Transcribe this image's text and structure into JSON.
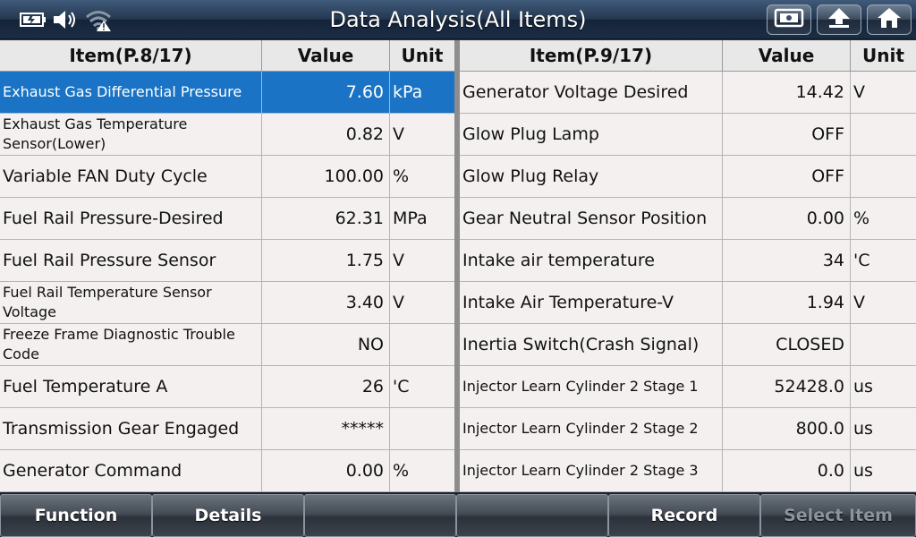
{
  "title": "Data Analysis(All Items)",
  "left_table": {
    "headers": {
      "item": "Item(P.8/17)",
      "value": "Value",
      "unit": "Unit"
    },
    "rows": [
      {
        "name": "Exhaust Gas Differential Pressure",
        "value": "7.60",
        "unit": "kPa"
      },
      {
        "name": "Exhaust Gas Temperature Sensor(Lower)",
        "value": "0.82",
        "unit": "V"
      },
      {
        "name": "Variable FAN Duty Cycle",
        "value": "100.00",
        "unit": "%"
      },
      {
        "name": "Fuel Rail Pressure-Desired",
        "value": "62.31",
        "unit": "MPa"
      },
      {
        "name": "Fuel Rail Pressure Sensor",
        "value": "1.75",
        "unit": "V"
      },
      {
        "name": "Fuel Rail Temperature Sensor Voltage",
        "value": "3.40",
        "unit": "V"
      },
      {
        "name": "Freeze Frame Diagnostic Trouble Code",
        "value": "NO",
        "unit": ""
      },
      {
        "name": "Fuel Temperature A",
        "value": "26",
        "unit": "'C"
      },
      {
        "name": "Transmission Gear Engaged",
        "value": "*****",
        "unit": ""
      },
      {
        "name": "Generator Command",
        "value": "0.00",
        "unit": "%"
      }
    ]
  },
  "right_table": {
    "headers": {
      "item": "Item(P.9/17)",
      "value": "Value",
      "unit": "Unit"
    },
    "rows": [
      {
        "name": "Generator Voltage Desired",
        "value": "14.42",
        "unit": "V"
      },
      {
        "name": "Glow Plug Lamp",
        "value": "OFF",
        "unit": ""
      },
      {
        "name": "Glow Plug Relay",
        "value": "OFF",
        "unit": ""
      },
      {
        "name": "Gear Neutral Sensor Position",
        "value": "0.00",
        "unit": "%"
      },
      {
        "name": "Intake air temperature",
        "value": "34",
        "unit": "'C"
      },
      {
        "name": "Intake Air Temperature-V",
        "value": "1.94",
        "unit": "V"
      },
      {
        "name": "Inertia Switch(Crash Signal)",
        "value": "CLOSED",
        "unit": ""
      },
      {
        "name": "Injector Learn Cylinder 2 Stage 1",
        "value": "52428.0",
        "unit": "us"
      },
      {
        "name": "Injector Learn Cylinder 2 Stage 2",
        "value": "800.0",
        "unit": "us"
      },
      {
        "name": "Injector Learn Cylinder 2 Stage 3",
        "value": "0.0",
        "unit": "us"
      }
    ]
  },
  "bottom_buttons": {
    "function": "Function",
    "details": "Details",
    "empty1": "",
    "empty2": "",
    "record": "Record",
    "select_item": "Select Item"
  },
  "colors": {
    "selected_row": "#1a73c4",
    "title_bar": "#24384f",
    "disabled_text": "#8e949b"
  },
  "icons": [
    "battery-icon",
    "speaker-icon",
    "wifi-icon",
    "screenshot-icon",
    "up-arrow-icon",
    "home-icon"
  ]
}
